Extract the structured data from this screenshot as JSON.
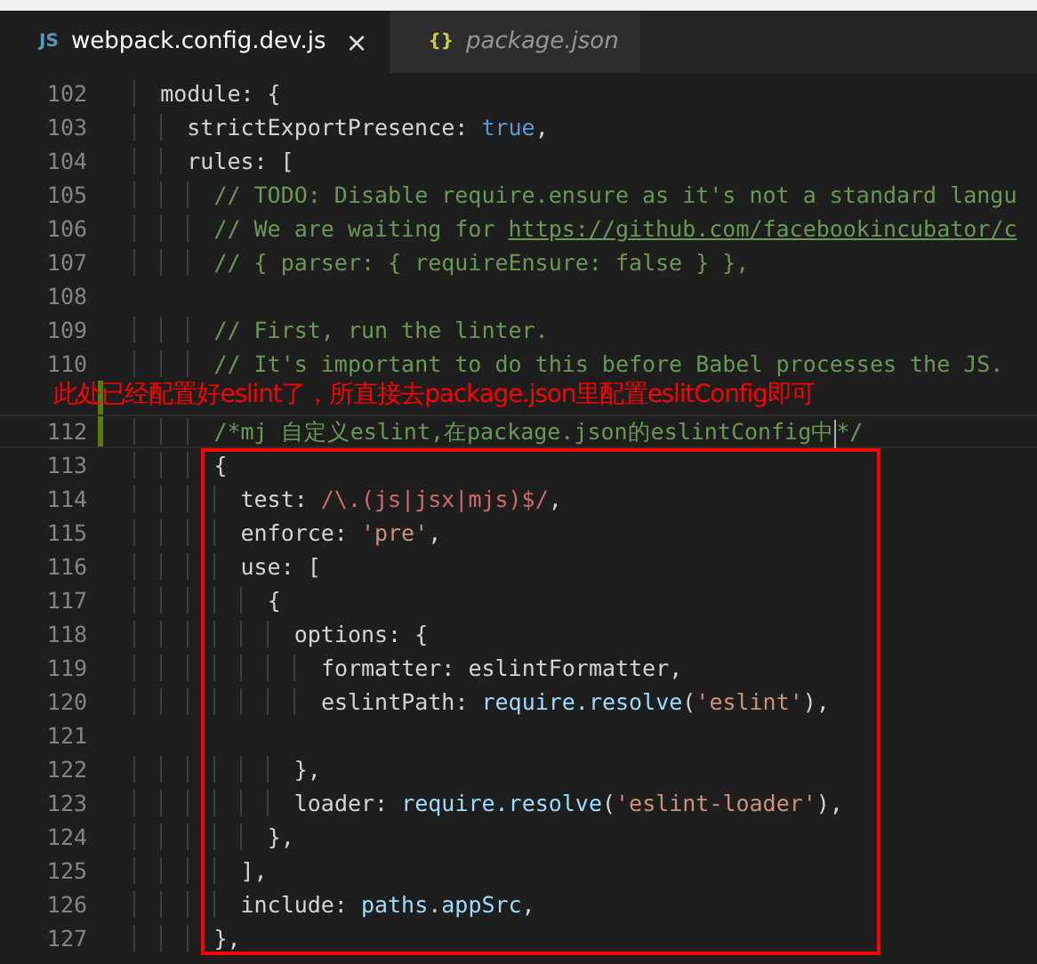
{
  "tabs": [
    {
      "icon_text": "JS",
      "color": "#519aba",
      "label": "webpack.config.dev.js",
      "close": "×",
      "selected": true,
      "preview": false
    },
    {
      "icon_text": "{}",
      "color": "#cbcb41",
      "label": "package.json",
      "selected": false,
      "preview": true
    }
  ],
  "editor": {
    "lines": [
      {
        "number": "102",
        "current": false,
        "modified": false,
        "tokens": [
          {
            "kind": "plain",
            "text": "  module: {"
          }
        ]
      },
      {
        "number": "103",
        "current": false,
        "modified": false,
        "tokens": [
          {
            "kind": "plain",
            "text": "    strictExportPresence: "
          },
          {
            "kind": "keyword",
            "text": "true"
          },
          {
            "kind": "plain",
            "text": ","
          }
        ]
      },
      {
        "number": "104",
        "current": false,
        "modified": false,
        "tokens": [
          {
            "kind": "plain",
            "text": "    rules: ["
          }
        ]
      },
      {
        "number": "105",
        "current": false,
        "modified": false,
        "tokens": [
          {
            "kind": "comment",
            "text": "      // TODO: Disable require.ensure as it's not a standard langu"
          }
        ]
      },
      {
        "number": "106",
        "current": false,
        "modified": false,
        "tokens": [
          {
            "kind": "comment",
            "text": "      // We are waiting for "
          },
          {
            "kind": "link",
            "text": "https://github.com/facebookincubator/c"
          }
        ]
      },
      {
        "number": "107",
        "current": false,
        "modified": false,
        "tokens": [
          {
            "kind": "comment",
            "text": "      // { parser: { requireEnsure: false } },"
          }
        ]
      },
      {
        "number": "108",
        "current": false,
        "modified": false
      },
      {
        "number": "109",
        "current": false,
        "modified": false,
        "tokens": [
          {
            "kind": "comment",
            "text": "      // First, run the linter."
          }
        ]
      },
      {
        "number": "110",
        "current": false,
        "modified": false,
        "tokens": [
          {
            "kind": "comment",
            "text": "      // It's important to do this before Babel processes the JS."
          }
        ]
      },
      {
        "current": false,
        "modified": true
      },
      {
        "number": "112",
        "current": true,
        "modified": true,
        "tokens": [
          {
            "kind": "comment",
            "text": "      /*mj 自定义eslint,在package.json的eslintConfig中"
          },
          {
            "kind": "cursor"
          },
          {
            "kind": "comment",
            "text": "*/"
          }
        ]
      },
      {
        "number": "113",
        "current": false,
        "modified": false,
        "tokens": [
          {
            "kind": "plain",
            "text": "      {"
          }
        ]
      },
      {
        "number": "114",
        "current": false,
        "modified": false,
        "tokens": [
          {
            "kind": "plain",
            "text": "        test: "
          },
          {
            "kind": "regex",
            "text": "/\\.(js|jsx|mjs)$/"
          },
          {
            "kind": "plain",
            "text": ","
          }
        ]
      },
      {
        "number": "115",
        "current": false,
        "modified": false,
        "tokens": [
          {
            "kind": "plain",
            "text": "        enforce: "
          },
          {
            "kind": "string",
            "text": "'pre'"
          },
          {
            "kind": "plain",
            "text": ","
          }
        ]
      },
      {
        "number": "116",
        "current": false,
        "modified": false,
        "tokens": [
          {
            "kind": "plain",
            "text": "        use: ["
          }
        ]
      },
      {
        "number": "117",
        "current": false,
        "modified": false,
        "tokens": [
          {
            "kind": "plain",
            "text": "          {"
          }
        ]
      },
      {
        "number": "118",
        "current": false,
        "modified": false,
        "tokens": [
          {
            "kind": "plain",
            "text": "            options: {"
          }
        ]
      },
      {
        "number": "119",
        "current": false,
        "modified": false,
        "tokens": [
          {
            "kind": "plain",
            "text": "              formatter: eslintFormatter,"
          }
        ]
      },
      {
        "number": "120",
        "current": false,
        "modified": false,
        "tokens": [
          {
            "kind": "plain",
            "text": "              eslintPath: "
          },
          {
            "kind": "func",
            "text": "require.resolve"
          },
          {
            "kind": "plain",
            "text": "("
          },
          {
            "kind": "string",
            "text": "'eslint'"
          },
          {
            "kind": "plain",
            "text": "),"
          }
        ]
      },
      {
        "number": "121",
        "current": false,
        "modified": false
      },
      {
        "number": "122",
        "current": false,
        "modified": false,
        "tokens": [
          {
            "kind": "plain",
            "text": "            },"
          }
        ]
      },
      {
        "number": "123",
        "current": false,
        "modified": false,
        "tokens": [
          {
            "kind": "plain",
            "text": "            loader: "
          },
          {
            "kind": "func",
            "text": "require.resolve"
          },
          {
            "kind": "plain",
            "text": "("
          },
          {
            "kind": "string",
            "text": "'eslint-loader'"
          },
          {
            "kind": "plain",
            "text": "),"
          }
        ]
      },
      {
        "number": "124",
        "current": false,
        "modified": false,
        "tokens": [
          {
            "kind": "plain",
            "text": "          },"
          }
        ]
      },
      {
        "number": "125",
        "current": false,
        "modified": false,
        "tokens": [
          {
            "kind": "plain",
            "text": "        ],"
          }
        ]
      },
      {
        "number": "126",
        "current": false,
        "modified": false,
        "tokens": [
          {
            "kind": "plain",
            "text": "        include: "
          },
          {
            "kind": "func",
            "text": "paths.appSrc"
          },
          {
            "kind": "plain",
            "text": ","
          }
        ]
      },
      {
        "number": "127",
        "current": false,
        "modified": false,
        "tokens": [
          {
            "kind": "plain",
            "text": "      },"
          }
        ]
      }
    ]
  },
  "annotation": {
    "text": "此处已经配置好eslint了，所直接去package.json里配置eslitConfig即可"
  }
}
